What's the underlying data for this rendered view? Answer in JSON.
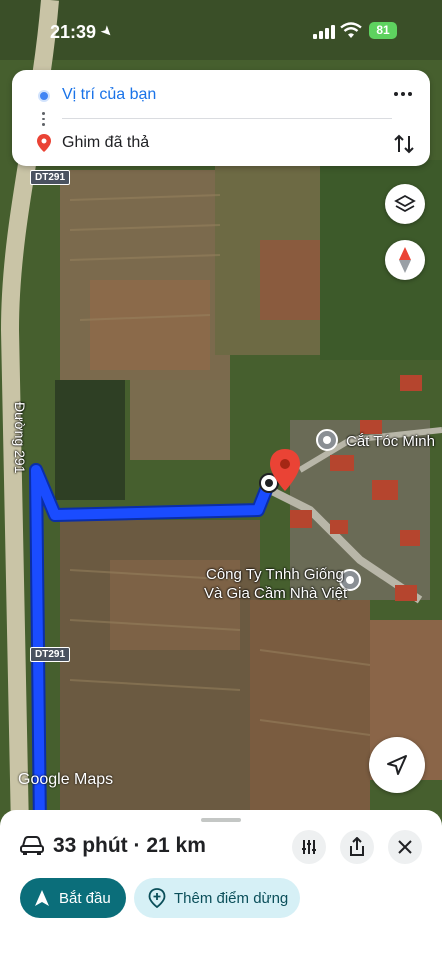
{
  "status_bar": {
    "time": "21:39",
    "battery": "81"
  },
  "directions": {
    "from": "Vị trí của bạn",
    "to": "Ghim đã thả"
  },
  "map": {
    "road_badge_top": "DT291",
    "road_badge_bottom": "DT291",
    "road_name": "Đường 291",
    "poi_1": "Cắt Tóc Minh",
    "poi_2_line1": "Công Ty Tnhh Giống",
    "poi_2_line2": "Và Gia Cầm Nhà Việt",
    "watermark": "Google Maps"
  },
  "route_summary": {
    "text": "33 phút · 21 km"
  },
  "actions": {
    "start": "Bắt đầu",
    "add_stop": "Thêm điểm dừng"
  },
  "colors": {
    "route": "#1a4cff",
    "pin": "#ea4335",
    "start_button": "#0b6e7a",
    "add_stop_button": "#d6f0f6",
    "battery": "#5ed25f"
  }
}
